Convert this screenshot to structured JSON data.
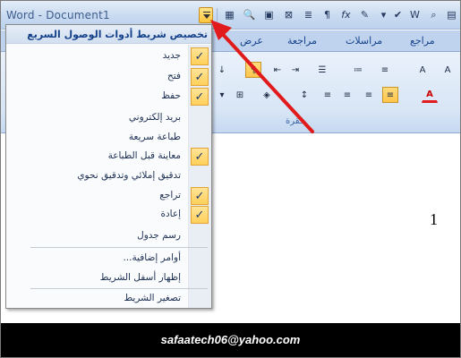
{
  "window": {
    "title": "Word - Document1"
  },
  "qat_icons": [
    "table-icon",
    "print-preview-icon",
    "image-icon",
    "close-box-icon",
    "list-icon",
    "pilcrow-icon",
    "function-icon",
    "format-painter-icon",
    "spell-check-icon",
    "word-icon",
    "find-icon"
  ],
  "tabs": [
    "عرض",
    "مراجعة",
    "مراسلات",
    "مراجع"
  ],
  "ribbon": {
    "group_label_partial": "فقرة"
  },
  "menu": {
    "header": "تخصيص شريط أدوات الوصول السريع",
    "items": [
      {
        "label": "جديد",
        "checked": true
      },
      {
        "label": "فتح",
        "checked": true
      },
      {
        "label": "حفظ",
        "checked": true
      },
      {
        "label": "بريد إلكتروني",
        "checked": false
      },
      {
        "label": "طباعة سريعة",
        "checked": false
      },
      {
        "label": "معاينة قبل الطباعة",
        "checked": true
      },
      {
        "label": "تدقيق إملائي وتدقيق نحوي",
        "checked": false
      },
      {
        "label": "تراجع",
        "checked": true
      },
      {
        "label": "إعادة",
        "checked": true
      },
      {
        "label": "رسم جدول",
        "checked": false
      }
    ],
    "more_commands": "أوامر إضافية...",
    "show_below": "إظهار أسفل الشريط",
    "minimize": "تصغير الشريط"
  },
  "document": {
    "text": "1"
  },
  "footer": {
    "text": "safaatech06@yahoo.com"
  },
  "colors": {
    "accent_red": "#e11b1b",
    "check_bg": "#ffd05b",
    "ribbon_blue": "#bfd3ee"
  }
}
